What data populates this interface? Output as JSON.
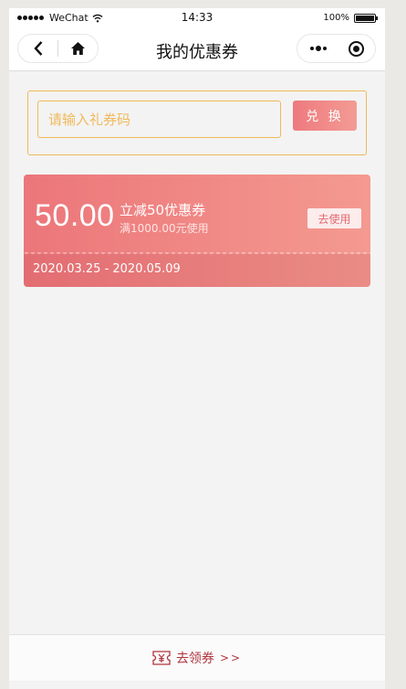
{
  "status_bar": {
    "carrier": "WeChat",
    "time": "14:33",
    "battery": "100%"
  },
  "nav": {
    "title": "我的优惠券"
  },
  "redeem": {
    "placeholder": "请输入礼券码",
    "button_label": "兑 换"
  },
  "coupons": [
    {
      "amount": "50.00",
      "title": "立减50优惠券",
      "condition": "满1000.00元使用",
      "action_label": "去使用",
      "period": "2020.03.25 - 2020.05.09"
    }
  ],
  "bottom_bar": {
    "label": "去领券",
    "arrows": ">>"
  },
  "colors": {
    "accent_orange": "#f0b95a",
    "coupon_gradient_start": "#ec767a",
    "coupon_gradient_end": "#f49a90",
    "bottom_link": "#b0353c"
  },
  "icons": [
    "back-icon",
    "home-icon",
    "more-icon",
    "close-icon",
    "coupon-ticket-icon",
    "wifi-icon",
    "battery-icon",
    "signal-icon"
  ]
}
